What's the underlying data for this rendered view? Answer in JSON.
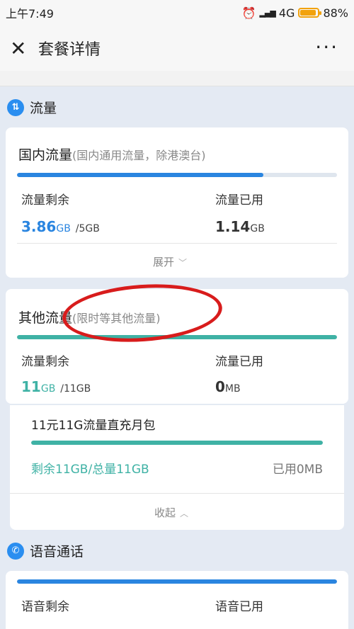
{
  "status_bar": {
    "time": "上午7:49",
    "network": "4G",
    "battery": "88%",
    "battery_level": 0.88
  },
  "header": {
    "title": "套餐详情"
  },
  "data_section": {
    "title": "流量"
  },
  "domestic": {
    "title": "国内流量",
    "subtitle": "(国内通用流量，除港澳台)",
    "usage_fraction": 0.77,
    "remaining_label": "流量剩余",
    "remaining_value": "3.86",
    "remaining_unit": "GB",
    "total": "/5GB",
    "used_label": "流量已用",
    "used_value": "1.14",
    "used_unit": "GB",
    "toggle_label": "展开"
  },
  "other": {
    "title": "其他流量",
    "subtitle": "(限时等其他流量)",
    "usage_fraction": 1.0,
    "remaining_label": "流量剩余",
    "remaining_value": "11",
    "remaining_unit": "GB",
    "total": "/11GB",
    "used_label": "流量已用",
    "used_value": "0",
    "used_unit": "MB"
  },
  "package": {
    "name": "11元11G流量直充月包",
    "usage_fraction": 1.0,
    "summary": "剩余11GB/总量11GB",
    "used": "已用0MB",
    "toggle_label": "收起"
  },
  "voice_section": {
    "title": "语音通话"
  },
  "voice": {
    "remaining_label": "语音剩余",
    "used_label": "语音已用",
    "usage_fraction": 1.0
  },
  "colors": {
    "blue": "#2a85e0",
    "teal": "#3fb2a5",
    "value_blue": "#2a85e0",
    "value_teal": "#3fb2a5"
  }
}
